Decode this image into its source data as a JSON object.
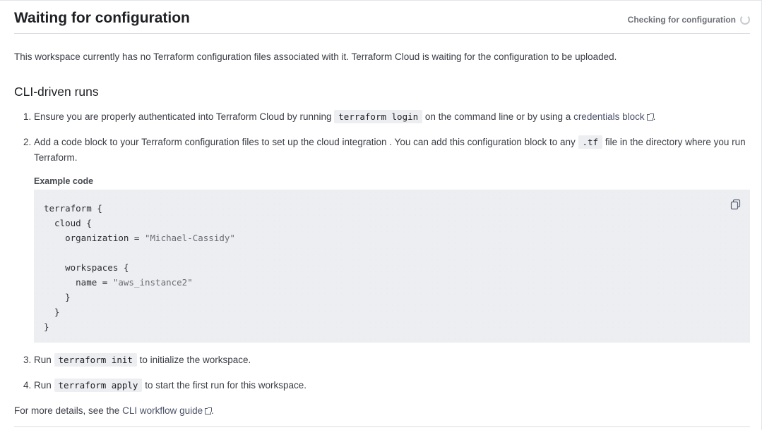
{
  "header": {
    "title": "Waiting for configuration",
    "status": "Checking for configuration"
  },
  "intro": "This workspace currently has no Terraform configuration files associated with it. Terraform Cloud is waiting for the configuration to be uploaded.",
  "section_title": "CLI-driven runs",
  "steps": [
    {
      "before": "Ensure you are properly authenticated into Terraform Cloud by running",
      "code": "terraform login",
      "middle": "on the command line or by using a",
      "link": "credentials block",
      "after": "."
    },
    {
      "before": "Add a code block to your Terraform configuration files to set up the cloud integration . You can add this configuration block to any",
      "code": ".tf",
      "after": "file in the directory where you run Terraform."
    },
    {
      "before": "Run",
      "code": "terraform init",
      "after": "to initialize the workspace."
    },
    {
      "before": "Run",
      "code": "terraform apply",
      "after": "to start the first run for this workspace."
    }
  ],
  "example": {
    "label": "Example code",
    "lines": {
      "l1": "terraform {",
      "l2": "  cloud {",
      "l3_key": "    organization = ",
      "l3_val": "\"Michael-Cassidy\"",
      "l5": "    workspaces {",
      "l6_key": "      name = ",
      "l6_val": "\"aws_instance2\"",
      "l7": "    }",
      "l8": "  }",
      "l9": "}"
    }
  },
  "footer": {
    "before": "For more details, see the",
    "link": "CLI workflow guide",
    "after": "."
  },
  "icons": {
    "copy": "copy-icon",
    "external": "external-link-icon",
    "spinner": "loading-spinner-icon"
  }
}
